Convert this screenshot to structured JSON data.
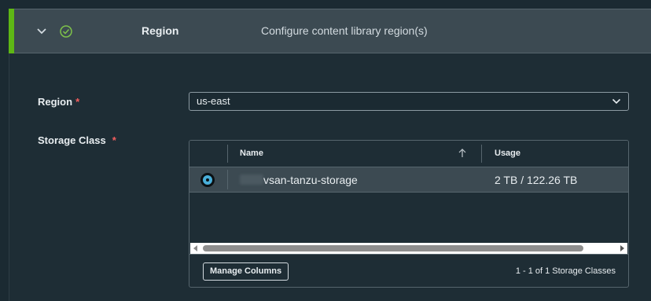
{
  "header": {
    "title": "Region",
    "description": "Configure content library region(s)",
    "collapse_icon": "chevron-down-icon",
    "status_icon": "check-circle-icon",
    "accent_color": "#5eb715"
  },
  "form": {
    "region": {
      "label": "Region",
      "required_mark": "*",
      "value": "us-east"
    },
    "storage_class": {
      "label": "Storage Class",
      "required_mark": "*"
    }
  },
  "grid": {
    "columns": [
      "Name",
      "Usage"
    ],
    "rows": [
      {
        "name": "vsan-tanzu-storage",
        "usage": "2 TB / 122.26 TB",
        "selected": true
      }
    ],
    "manage_columns_label": "Manage Columns",
    "pagination": "1 - 1 of 1 Storage Classes"
  }
}
